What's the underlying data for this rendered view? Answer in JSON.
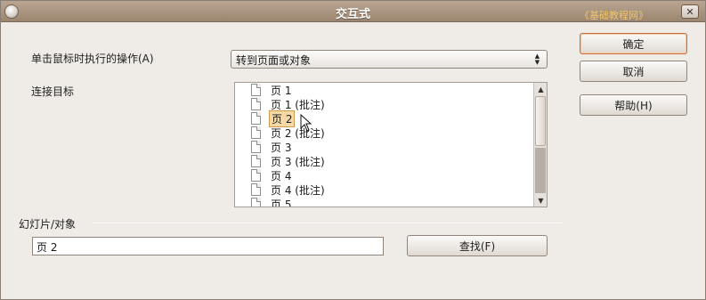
{
  "window": {
    "title": "交互式",
    "watermark": "《基础教程网》",
    "close_symbol": "✕"
  },
  "action": {
    "label": "单击鼠标时执行的操作(A)",
    "selected": "转到页面或对象"
  },
  "link_target": {
    "label": "连接目标",
    "items": [
      "页 1",
      "页 1 (批注)",
      "页 2",
      "页 2 (批注)",
      "页 3",
      "页 3 (批注)",
      "页 4",
      "页 4 (批注)",
      "页 5"
    ],
    "selected_index": 2
  },
  "slide_object": {
    "section_label": "幻灯片/对象",
    "value": "页 2",
    "find_button": "查找(F)"
  },
  "buttons": {
    "ok": "确定",
    "cancel": "取消",
    "help": "帮助(H)"
  }
}
